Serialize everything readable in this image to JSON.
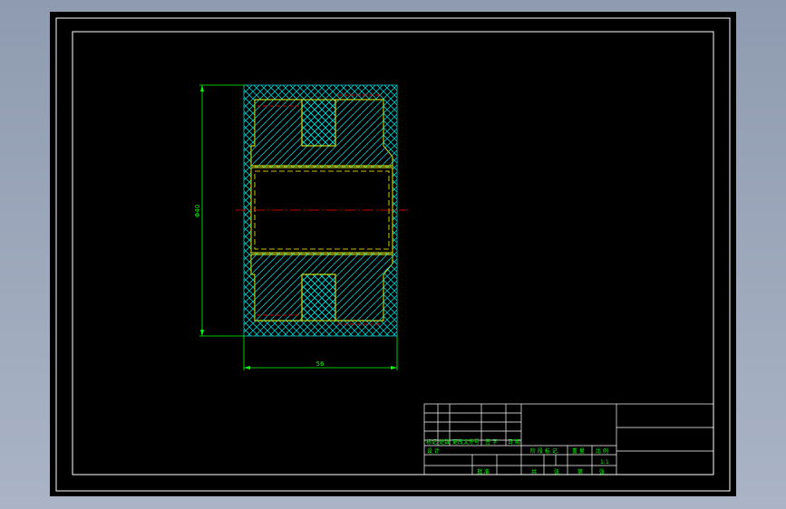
{
  "canvas": {
    "background": "#000000",
    "frame_color": "#ffffff",
    "dim_color": "#00ff00",
    "hatch_color": "#00c8c8",
    "outline_color": "#ffff00",
    "centerline_color": "#ff0000"
  },
  "dimensions": {
    "vertical_label": "Φ40",
    "horizontal_label": "56"
  },
  "title_block": {
    "row_labels": [
      "标记",
      "处数",
      "更改文件号",
      "签 字",
      "日 期"
    ],
    "design": "设 计",
    "stage_labels": [
      "阶 段 标 记",
      "重 量",
      "比 例"
    ],
    "scale": "1:1",
    "sheet_labels": [
      "共",
      "张",
      "第",
      "张"
    ],
    "approve": "批 准"
  }
}
